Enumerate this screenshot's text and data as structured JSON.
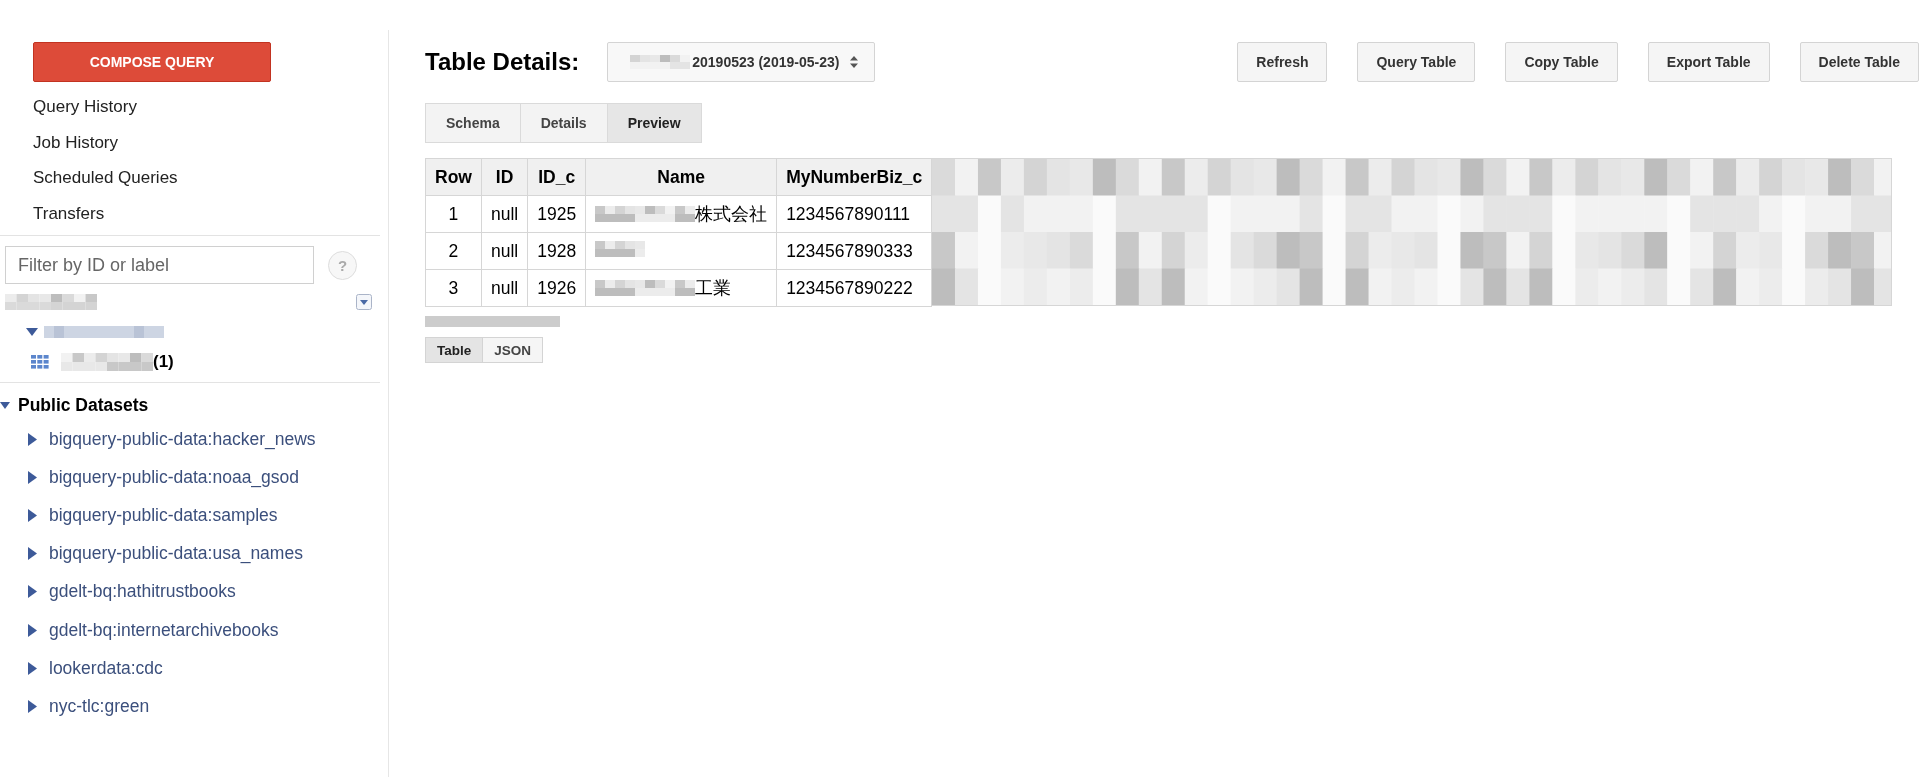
{
  "sidebar": {
    "compose_button": "COMPOSE QUERY",
    "nav": [
      "Query History",
      "Job History",
      "Scheduled Queries",
      "Transfers"
    ],
    "filter": {
      "placeholder": "Filter by ID or label"
    },
    "help": "?",
    "project": {
      "expanded": true,
      "datasets": [
        {
          "expanded": true,
          "tables": [
            {
              "count": "(1)"
            }
          ]
        }
      ]
    },
    "public_datasets": {
      "title": "Public Datasets",
      "expanded": true,
      "items": [
        {
          "label": "bigquery-public-data:hacker_news",
          "expanded": false
        },
        {
          "label": "bigquery-public-data:noaa_gsod",
          "expanded": false
        },
        {
          "label": "bigquery-public-data:samples",
          "expanded": false
        },
        {
          "label": "bigquery-public-data:usa_names",
          "expanded": false
        },
        {
          "label": "gdelt-bq:hathitrustbooks",
          "expanded": false
        },
        {
          "label": "gdelt-bq:internetarchivebooks",
          "expanded": false
        },
        {
          "label": "lookerdata:cdc",
          "expanded": false
        },
        {
          "label": "nyc-tlc:green",
          "expanded": false
        }
      ]
    }
  },
  "main": {
    "title": "Table Details:",
    "table_select": "20190523 (2019-05-23)",
    "actions": [
      "Refresh",
      "Query Table",
      "Copy Table",
      "Export Table",
      "Delete Table"
    ],
    "tabs": [
      {
        "label": "Schema",
        "selected": false
      },
      {
        "label": "Details",
        "selected": false
      },
      {
        "label": "Preview",
        "selected": true
      }
    ],
    "table": {
      "columns": [
        "Row",
        "ID",
        "ID_c",
        "Name",
        "MyNumberBiz_c"
      ],
      "rows": [
        {
          "cells": [
            "1",
            "null",
            "1925",
            "株式会社",
            "1234567890111"
          ]
        },
        {
          "cells": [
            "2",
            "null",
            "1928",
            null,
            "1234567890333"
          ]
        },
        {
          "cells": [
            "3",
            "null",
            "1926",
            "工業",
            "1234567890222"
          ]
        }
      ]
    },
    "view_toggle": [
      {
        "label": "Table",
        "selected": true
      },
      {
        "label": "JSON",
        "selected": false
      }
    ]
  }
}
